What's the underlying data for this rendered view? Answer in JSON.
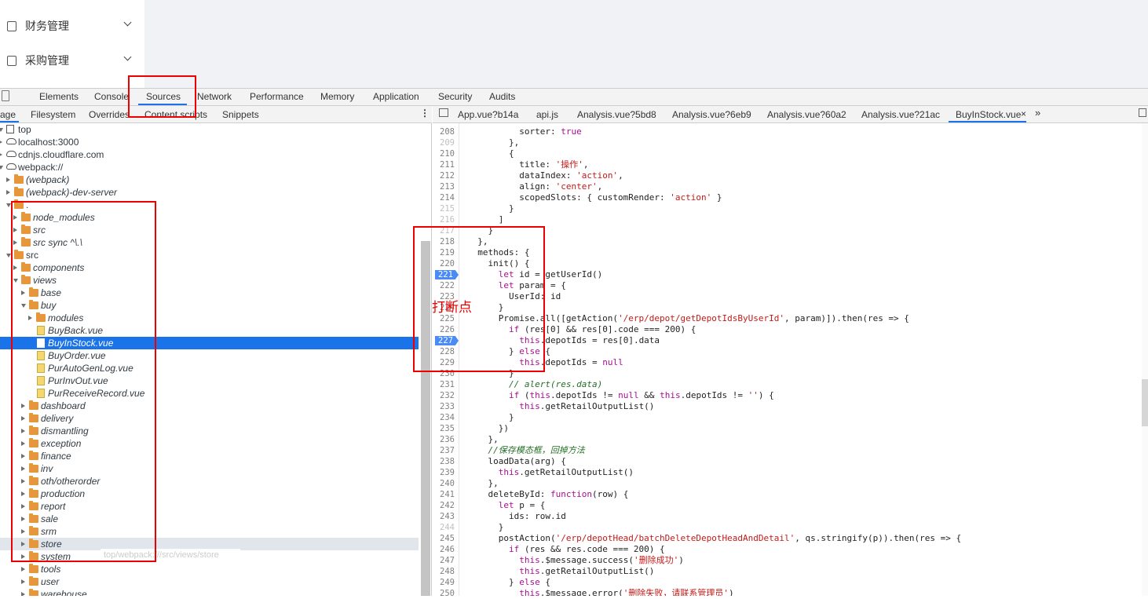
{
  "side_menu": {
    "items": [
      {
        "label": "财务管理",
        "icon": "finance-icon"
      },
      {
        "label": "采购管理",
        "icon": "purchase-icon"
      }
    ]
  },
  "devtools": {
    "tabs": [
      "Elements",
      "Console",
      "Sources",
      "Network",
      "Performance",
      "Memory",
      "Application",
      "Security",
      "Audits"
    ],
    "active_tab": "Sources",
    "nav_subtabs": [
      "age",
      "Filesystem",
      "Overrides",
      "Content scripts",
      "Snippets"
    ],
    "tree": [
      {
        "label": "top",
        "type": "frame",
        "depth": 0,
        "open": true
      },
      {
        "label": "localhost:3000",
        "type": "cloud",
        "depth": 0,
        "open": false
      },
      {
        "label": "cdnjs.cloudflare.com",
        "type": "cloud",
        "depth": 0,
        "open": false
      },
      {
        "label": "webpack://",
        "type": "cloud",
        "depth": 0,
        "open": true
      },
      {
        "label": "(webpack)",
        "type": "folder",
        "depth": 1,
        "open": false,
        "italic": true
      },
      {
        "label": "(webpack)-dev-server",
        "type": "folder",
        "depth": 1,
        "open": false,
        "italic": true
      },
      {
        "label": ".",
        "type": "folder",
        "depth": 1,
        "open": true
      },
      {
        "label": "node_modules",
        "type": "folder",
        "depth": 2,
        "open": false,
        "italic": true
      },
      {
        "label": "src",
        "type": "folder",
        "depth": 2,
        "open": false,
        "italic": true
      },
      {
        "label": "src sync ^\\.\\",
        "type": "folder",
        "depth": 2,
        "open": false,
        "italic": true
      },
      {
        "label": "src",
        "type": "folder",
        "depth": 1,
        "open": true
      },
      {
        "label": "components",
        "type": "folder",
        "depth": 2,
        "open": false,
        "italic": true
      },
      {
        "label": "views",
        "type": "folder",
        "depth": 2,
        "open": true,
        "italic": true
      },
      {
        "label": "base",
        "type": "folder",
        "depth": 3,
        "open": false,
        "italic": true
      },
      {
        "label": "buy",
        "type": "folder",
        "depth": 3,
        "open": true,
        "italic": true
      },
      {
        "label": "modules",
        "type": "folder",
        "depth": 4,
        "open": false,
        "italic": true
      },
      {
        "label": "BuyBack.vue",
        "type": "file",
        "depth": 5,
        "italic": true
      },
      {
        "label": "BuyInStock.vue",
        "type": "file",
        "depth": 5,
        "italic": true,
        "selected": true
      },
      {
        "label": "BuyOrder.vue",
        "type": "file",
        "depth": 5,
        "italic": true
      },
      {
        "label": "PurAutoGenLog.vue",
        "type": "file",
        "depth": 5,
        "italic": true
      },
      {
        "label": "PurInvOut.vue",
        "type": "file",
        "depth": 5,
        "italic": true
      },
      {
        "label": "PurReceiveRecord.vue",
        "type": "file",
        "depth": 5,
        "italic": true
      },
      {
        "label": "dashboard",
        "type": "folder",
        "depth": 3,
        "open": false,
        "italic": true
      },
      {
        "label": "delivery",
        "type": "folder",
        "depth": 3,
        "open": false,
        "italic": true
      },
      {
        "label": "dismantling",
        "type": "folder",
        "depth": 3,
        "open": false,
        "italic": true
      },
      {
        "label": "exception",
        "type": "folder",
        "depth": 3,
        "open": false,
        "italic": true
      },
      {
        "label": "finance",
        "type": "folder",
        "depth": 3,
        "open": false,
        "italic": true
      },
      {
        "label": "inv",
        "type": "folder",
        "depth": 3,
        "open": false,
        "italic": true
      },
      {
        "label": "oth/otherorder",
        "type": "folder",
        "depth": 3,
        "open": false,
        "italic": true
      },
      {
        "label": "production",
        "type": "folder",
        "depth": 3,
        "open": false,
        "italic": true
      },
      {
        "label": "report",
        "type": "folder",
        "depth": 3,
        "open": false,
        "italic": true
      },
      {
        "label": "sale",
        "type": "folder",
        "depth": 3,
        "open": false,
        "italic": true
      },
      {
        "label": "srm",
        "type": "folder",
        "depth": 3,
        "open": false,
        "italic": true
      },
      {
        "label": "store",
        "type": "folder",
        "depth": 3,
        "open": false,
        "italic": true,
        "hover": true
      },
      {
        "label": "system",
        "type": "folder",
        "depth": 3,
        "open": false,
        "italic": true
      },
      {
        "label": "tools",
        "type": "folder",
        "depth": 3,
        "open": false,
        "italic": true
      },
      {
        "label": "user",
        "type": "folder",
        "depth": 3,
        "open": false,
        "italic": true
      },
      {
        "label": "warehouse",
        "type": "folder",
        "depth": 3,
        "open": false,
        "italic": true
      }
    ],
    "tooltip": "top/webpack:///src/views/store",
    "editor_tabs": [
      "App.vue?b14a",
      "api.js",
      "Analysis.vue?5bd8",
      "Analysis.vue?6eb9",
      "Analysis.vue?60a2",
      "Analysis.vue?21ac",
      "BuyInStock.vue"
    ],
    "active_editor_tab": "BuyInStock.vue",
    "breakpoints": [
      "221",
      "227"
    ],
    "code_lines": [
      {
        "n": "208",
        "t": "          sorter: true"
      },
      {
        "n": "209",
        "t": "        },",
        "faint": true
      },
      {
        "n": "210",
        "t": "        {"
      },
      {
        "n": "211",
        "t": "          title: '操作',"
      },
      {
        "n": "212",
        "t": "          dataIndex: 'action',"
      },
      {
        "n": "213",
        "t": "          align: 'center',"
      },
      {
        "n": "214",
        "t": "          scopedSlots: { customRender: 'action' }"
      },
      {
        "n": "215",
        "t": "        }",
        "faint": true
      },
      {
        "n": "216",
        "t": "      ]",
        "faint": true
      },
      {
        "n": "217",
        "t": "    }",
        "faint": true
      },
      {
        "n": "218",
        "t": "  },"
      },
      {
        "n": "219",
        "t": "  methods: {"
      },
      {
        "n": "220",
        "t": "    init() {"
      },
      {
        "n": "221",
        "t": "      let id = getUserId()"
      },
      {
        "n": "222",
        "t": "      let param = {"
      },
      {
        "n": "223",
        "t": "        UserId: id"
      },
      {
        "n": "224",
        "t": "      }"
      },
      {
        "n": "225",
        "t": "      Promise.all([getAction('/erp/depot/getDepotIdsByUserId', param)]).then(res => {"
      },
      {
        "n": "226",
        "t": "        if (res[0] && res[0].code === 200) {"
      },
      {
        "n": "227",
        "t": "          this.depotIds = res[0].data"
      },
      {
        "n": "228",
        "t": "        } else {"
      },
      {
        "n": "229",
        "t": "          this.depotIds = null"
      },
      {
        "n": "230",
        "t": "        }"
      },
      {
        "n": "231",
        "t": "        // alert(res.data)"
      },
      {
        "n": "232",
        "t": "        if (this.depotIds != null && this.depotIds != '') {"
      },
      {
        "n": "233",
        "t": "          this.getRetailOutputList()"
      },
      {
        "n": "234",
        "t": "        }"
      },
      {
        "n": "235",
        "t": "      })"
      },
      {
        "n": "236",
        "t": "    },"
      },
      {
        "n": "237",
        "t": "    //保存模态框，回掉方法"
      },
      {
        "n": "238",
        "t": "    loadData(arg) {"
      },
      {
        "n": "239",
        "t": "      this.getRetailOutputList()"
      },
      {
        "n": "240",
        "t": "    },"
      },
      {
        "n": "241",
        "t": "    deleteById: function(row) {"
      },
      {
        "n": "242",
        "t": "      let p = {"
      },
      {
        "n": "243",
        "t": "        ids: row.id"
      },
      {
        "n": "244",
        "t": "      }",
        "faint": true
      },
      {
        "n": "245",
        "t": "      postAction('/erp/depotHead/batchDeleteDepotHeadAndDetail', qs.stringify(p)).then(res => {"
      },
      {
        "n": "246",
        "t": "        if (res && res.code === 200) {"
      },
      {
        "n": "247",
        "t": "          this.$message.success('删除成功')"
      },
      {
        "n": "248",
        "t": "          this.getRetailOutputList()"
      },
      {
        "n": "249",
        "t": "        } else {"
      },
      {
        "n": "250",
        "t": "          this.$message.error('删除失败，请联系管理员')"
      }
    ]
  },
  "annotation": {
    "text": "打断点",
    "color": "#e60000"
  },
  "colors": {
    "accent": "#1a73e8",
    "folder": "#e8963c",
    "keyword": "#aa0d91",
    "string": "#c41a16",
    "comment": "#236e25"
  }
}
